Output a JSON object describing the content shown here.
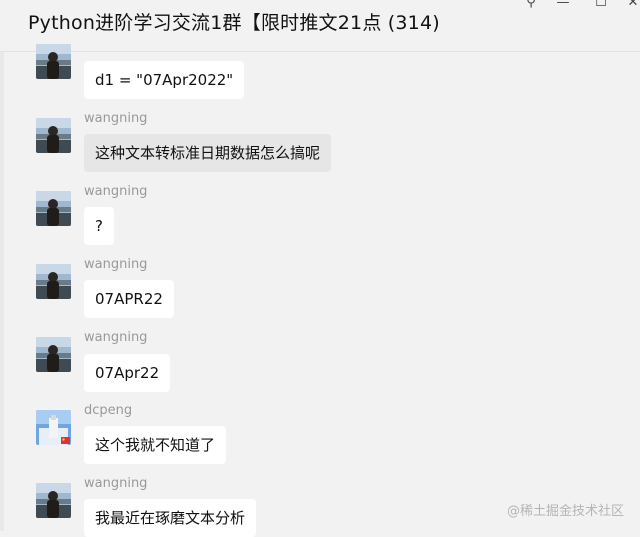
{
  "window": {
    "title": "Python进阶学习交流1群【限时推文21点 (314)",
    "pin_glyph": "⚲",
    "minimize_glyph": "—",
    "maximize_glyph": "☐",
    "close_glyph": "✕"
  },
  "messages": [
    {
      "sender": "",
      "text": "d1 = \"07Apr2022\"",
      "avatar": "wangning-avatar"
    },
    {
      "sender": "wangning",
      "text": "这种文本转标准日期数据怎么搞呢",
      "avatar": "wangning-avatar"
    },
    {
      "sender": "wangning",
      "text": "?",
      "avatar": "wangning-avatar"
    },
    {
      "sender": "wangning",
      "text": "07APR22",
      "avatar": "wangning-avatar"
    },
    {
      "sender": "wangning",
      "text": "07Apr22",
      "avatar": "wangning-avatar"
    },
    {
      "sender": "dcpeng",
      "text": "这个我就不知道了",
      "avatar": "dcpeng-avatar"
    },
    {
      "sender": "wangning",
      "text": "我最近在琢磨文本分析",
      "avatar": "wangning-avatar"
    }
  ],
  "watermark": "@稀土掘金技术社区",
  "colors": {
    "background": "#f2f2f2",
    "bubble": "#ffffff",
    "bubble_hover": "#e6e6e6",
    "sender_name": "#999999"
  }
}
